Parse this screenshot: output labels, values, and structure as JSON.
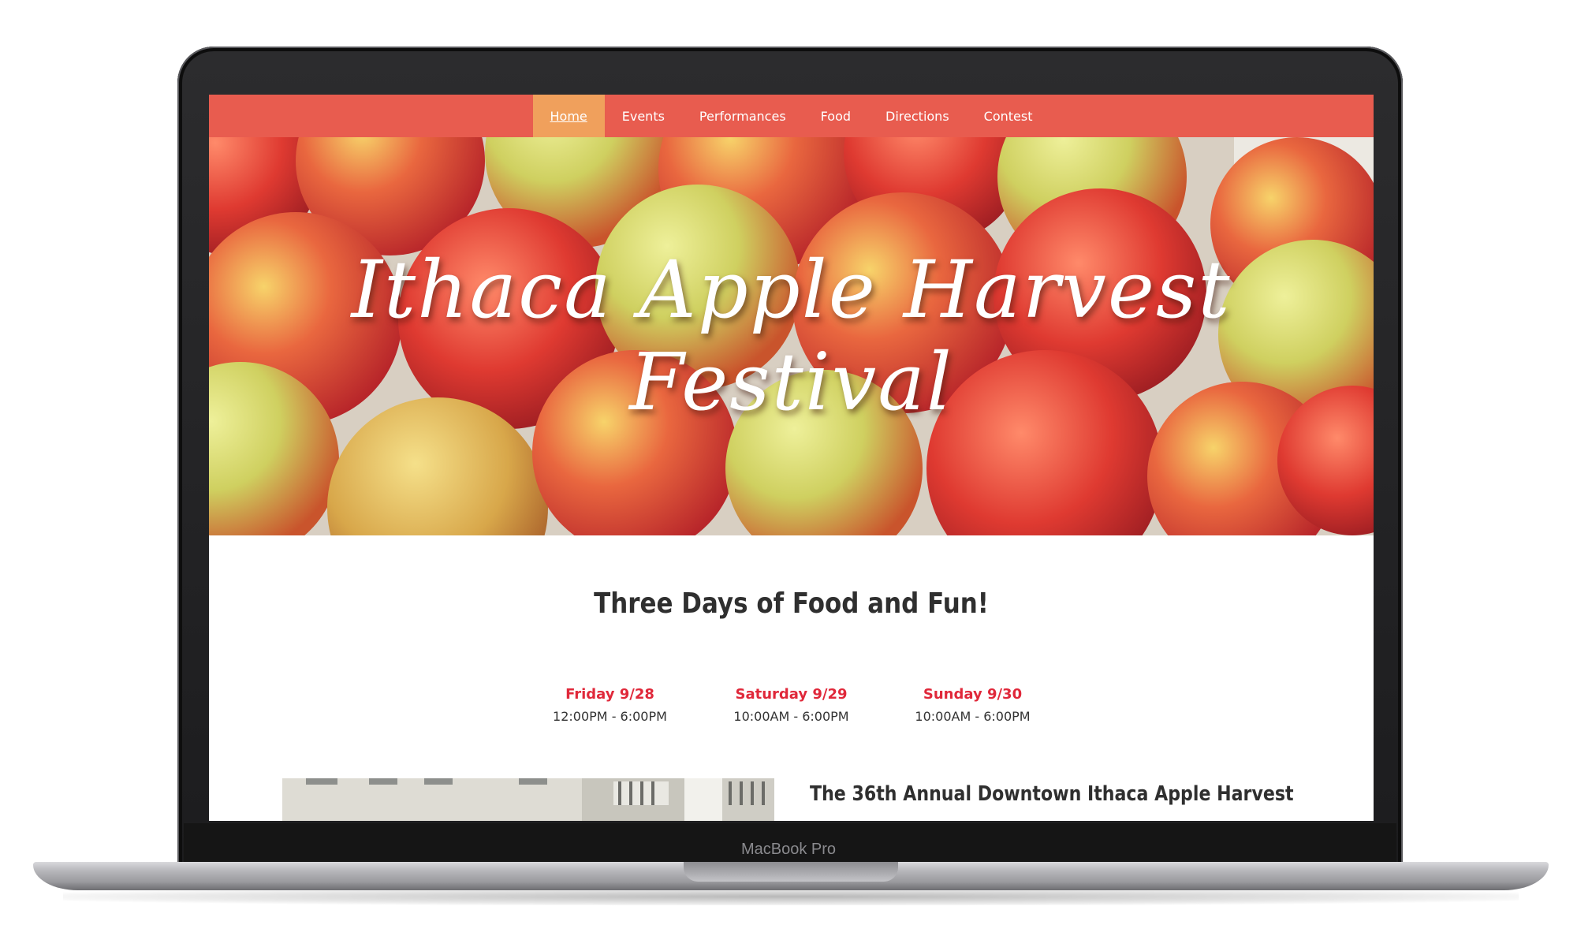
{
  "device": {
    "model_label": "MacBook Pro"
  },
  "nav": {
    "items": [
      {
        "label": "Home",
        "active": true
      },
      {
        "label": "Events"
      },
      {
        "label": "Performances"
      },
      {
        "label": "Food"
      },
      {
        "label": "Directions"
      },
      {
        "label": "Contest"
      }
    ]
  },
  "hero": {
    "title": "Ithaca Apple Harvest Festival"
  },
  "main": {
    "headline": "Three Days of Food and Fun!",
    "days": [
      {
        "name": "Friday 9/28",
        "hours": "12:00PM - 6:00PM"
      },
      {
        "name": "Saturday 9/29",
        "hours": "10:00AM - 6:00PM"
      },
      {
        "name": "Sunday 9/30",
        "hours": "10:00AM - 6:00PM"
      }
    ],
    "article_title": "The 36th Annual Downtown Ithaca Apple Harvest"
  },
  "colors": {
    "nav_bg": "#e85c4f",
    "nav_active_bg": "#f0a05c",
    "day_name": "#e0283a",
    "text_dark": "#2f2f2f"
  }
}
